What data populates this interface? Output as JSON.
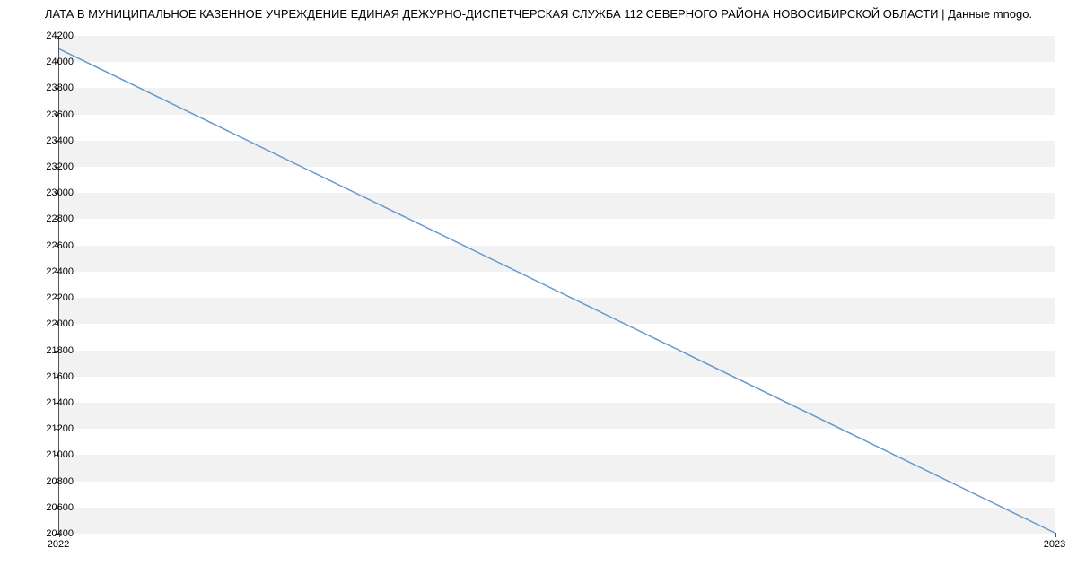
{
  "chart_data": {
    "type": "line",
    "title": "ЛАТА В МУНИЦИПАЛЬНОЕ КАЗЕННОЕ УЧРЕЖДЕНИЕ ЕДИНАЯ ДЕЖУРНО-ДИСПЕТЧЕРСКАЯ СЛУЖБА 112 СЕВЕРНОГО РАЙОНА НОВОСИБИРСКОЙ ОБЛАСТИ | Данные mnogo.",
    "x": [
      2022,
      2023
    ],
    "values": [
      24100,
      20400
    ],
    "x_ticks": [
      2022,
      2023
    ],
    "y_ticks": [
      20400,
      20600,
      20800,
      21000,
      21200,
      21400,
      21600,
      21800,
      22000,
      22200,
      22400,
      22600,
      22800,
      23000,
      23200,
      23400,
      23600,
      23800,
      24000,
      24200
    ],
    "ylim": [
      20400,
      24200
    ],
    "line_color": "#6699cc"
  }
}
